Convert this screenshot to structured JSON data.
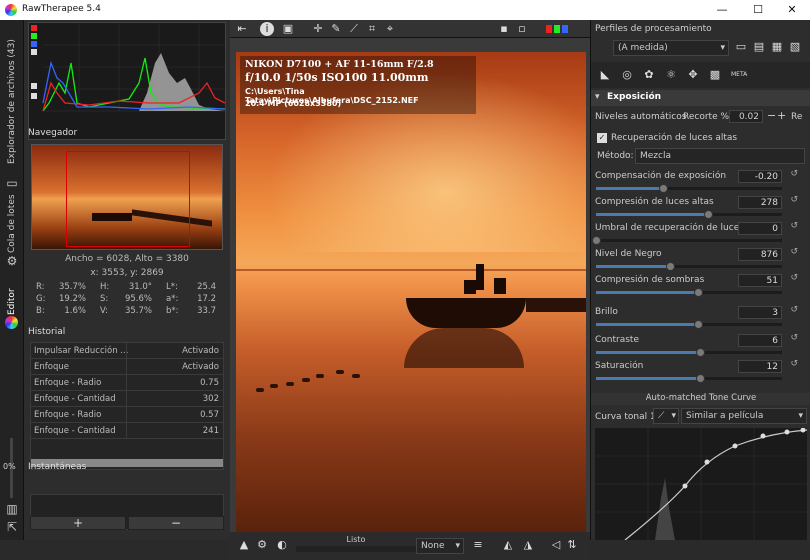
{
  "window": {
    "title": "RawTherapee 5.4",
    "minimize": "—",
    "maximize": "☐",
    "close": "✕"
  },
  "left_tabs": {
    "file_browser": "Explorador de archivos (43)",
    "queue": "Cola de lotes",
    "editor": "Editor",
    "percent": "0%"
  },
  "navigator": {
    "title": "Navegador",
    "size_text": "Ancho = 6028, Alto = 3380",
    "coords_text": "x: 3553, y: 2869",
    "rgb": [
      {
        "k": "R:",
        "v": "35.7%"
      },
      {
        "k": "G:",
        "v": "19.2%"
      },
      {
        "k": "B:",
        "v": "1.6%"
      }
    ],
    "hsv": [
      {
        "k": "H:",
        "v": "31.0°"
      },
      {
        "k": "S:",
        "v": "95.6%"
      },
      {
        "k": "V:",
        "v": "35.7%"
      }
    ],
    "lab": [
      {
        "k": "L*:",
        "v": "25.4"
      },
      {
        "k": "a*:",
        "v": "17.2"
      },
      {
        "k": "b*:",
        "v": "33.7"
      }
    ]
  },
  "history": {
    "title": "Historial",
    "rows": [
      {
        "a": "Impulsar Reducción ...",
        "b": "Activado"
      },
      {
        "a": "Enfoque",
        "b": "Activado"
      },
      {
        "a": "Enfoque - Radio",
        "b": "0.75"
      },
      {
        "a": "Enfoque - Cantidad",
        "b": "302"
      },
      {
        "a": "Enfoque - Radio",
        "b": "0.57"
      },
      {
        "a": "Enfoque - Cantidad",
        "b": "241"
      }
    ]
  },
  "snapshots": {
    "title": "Instantáneas",
    "add": "+",
    "remove": "−"
  },
  "exif": {
    "camera": "NIKON D7100 + AF 11-16mm F/2.8",
    "shot": "f/10.0  1/50s  ISO100  11.00mm",
    "path": "C:\\Users\\Tina Tatay\\Pictures\\Albufera\\DSC_2152.NEF",
    "mp": "20.4 MP (6028x3380)"
  },
  "bottom": {
    "status": "Listo",
    "none": "None"
  },
  "right": {
    "profiles_title": "Perfiles de procesamiento",
    "profile_value": "(A medida)",
    "meta_tab": "META",
    "exposure_title": "Exposición",
    "auto_levels": "Niveles automáticos",
    "clip_label": "Recorte %",
    "clip_value": "0.02",
    "clip_reset": "Re",
    "highlight_recovery": "Recuperación de luces altas",
    "method_label": "Método:",
    "method_value": "Mezcla",
    "sliders": [
      {
        "label": "Compensación de exposición",
        "value": "-0.20",
        "frac": 0.36
      },
      {
        "label": "Compresión de luces altas",
        "value": "278",
        "frac": 0.6
      },
      {
        "label": "Umbral de recuperación de luces altas",
        "value": "0",
        "frac": 0.0
      },
      {
        "label": "Nivel de Negro",
        "value": "876",
        "frac": 0.4
      },
      {
        "label": "Compresión de sombras",
        "value": "51",
        "frac": 0.55
      },
      {
        "label": "Brillo",
        "value": "3",
        "frac": 0.55
      },
      {
        "label": "Contraste",
        "value": "6",
        "frac": 0.56
      },
      {
        "label": "Saturación",
        "value": "12",
        "frac": 0.56
      }
    ],
    "tone_curve_title": "Auto-matched Tone Curve",
    "curve_label": "Curva tonal 1:",
    "curve_mode": "Similar a película"
  }
}
